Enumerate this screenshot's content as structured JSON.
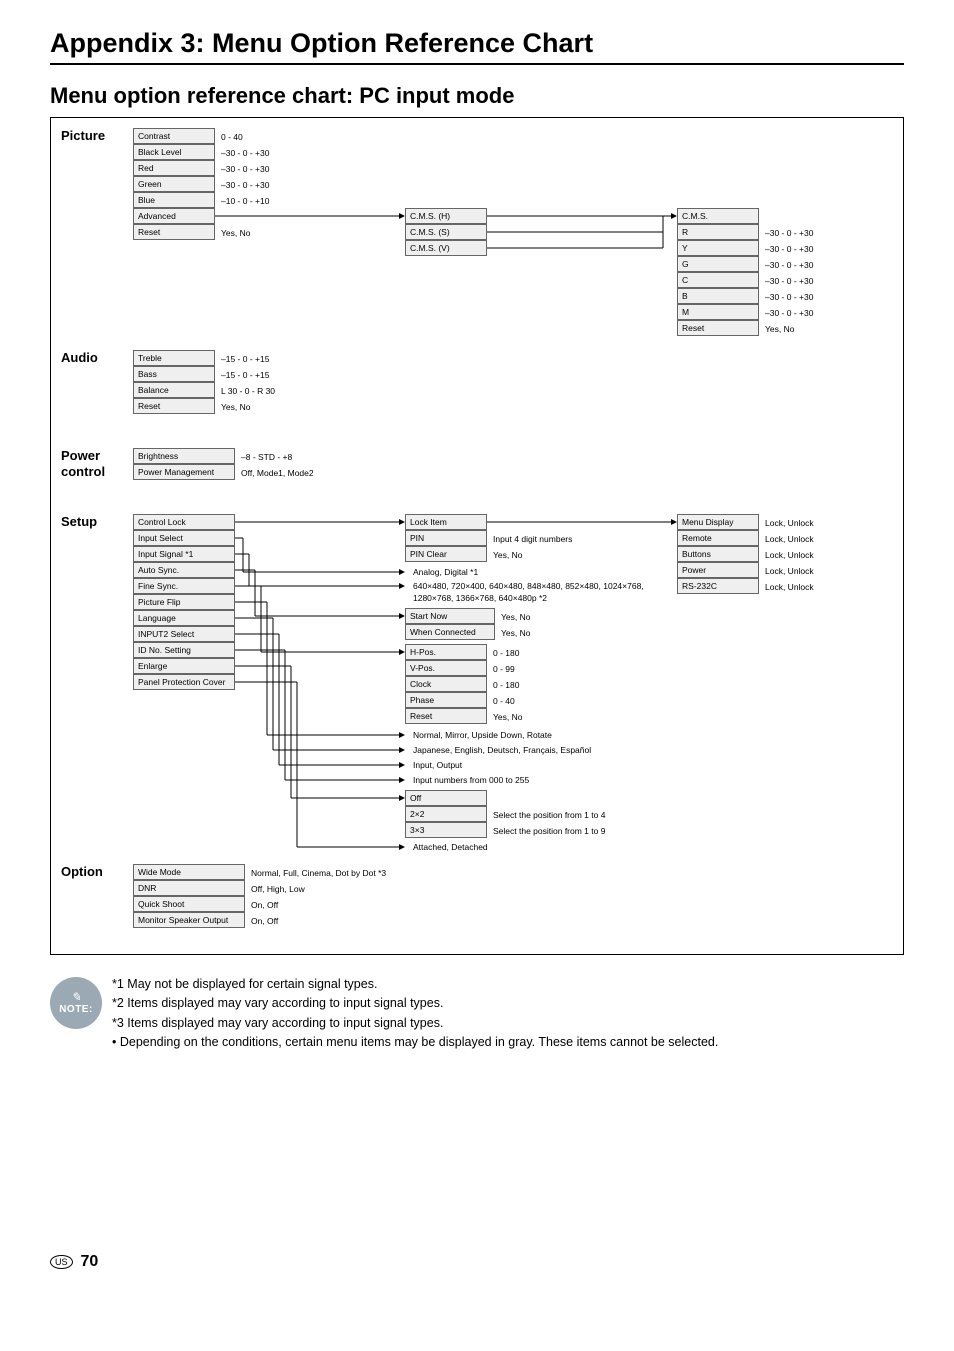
{
  "title": "Appendix 3: Menu Option Reference Chart",
  "subtitle": "Menu option reference chart: PC input mode",
  "sections": {
    "picture": {
      "label": "Picture",
      "rows": [
        {
          "name": "Contrast",
          "val": "0 - 40"
        },
        {
          "name": "Black Level",
          "val": "–30 - 0 - +30"
        },
        {
          "name": "Red",
          "val": "–30 - 0 - +30"
        },
        {
          "name": "Green",
          "val": "–30 - 0 - +30"
        },
        {
          "name": "Blue",
          "val": "–10 - 0 - +10"
        },
        {
          "name": "Advanced",
          "val": ""
        },
        {
          "name": "Reset",
          "val": "Yes, No"
        }
      ],
      "cms_mid": [
        {
          "name": "C.M.S. (H)"
        },
        {
          "name": "C.M.S. (S)"
        },
        {
          "name": "C.M.S. (V)"
        }
      ],
      "cms_right_head": "C.M.S.",
      "cms_right": [
        {
          "name": "R",
          "val": "–30 - 0 - +30"
        },
        {
          "name": "Y",
          "val": "–30 - 0 - +30"
        },
        {
          "name": "G",
          "val": "–30 - 0 - +30"
        },
        {
          "name": "C",
          "val": "–30 - 0 - +30"
        },
        {
          "name": "B",
          "val": "–30 - 0 - +30"
        },
        {
          "name": "M",
          "val": "–30 - 0 - +30"
        },
        {
          "name": "Reset",
          "val": "Yes, No"
        }
      ]
    },
    "audio": {
      "label": "Audio",
      "rows": [
        {
          "name": "Treble",
          "val": "–15 - 0 - +15"
        },
        {
          "name": "Bass",
          "val": "–15 - 0 - +15"
        },
        {
          "name": "Balance",
          "val": "L 30 - 0 - R 30"
        },
        {
          "name": "Reset",
          "val": "Yes, No"
        }
      ]
    },
    "power": {
      "label": "Power control",
      "rows": [
        {
          "name": "Brightness",
          "val": "–8 - STD - +8"
        },
        {
          "name": "Power Management",
          "val": "Off, Mode1, Mode2"
        }
      ]
    },
    "setup": {
      "label": "Setup",
      "rows": [
        {
          "name": "Control Lock"
        },
        {
          "name": "Input Select"
        },
        {
          "name": "Input Signal *1"
        },
        {
          "name": "Auto Sync."
        },
        {
          "name": "Fine Sync."
        },
        {
          "name": "Picture Flip"
        },
        {
          "name": "Language"
        },
        {
          "name": "INPUT2 Select"
        },
        {
          "name": "ID No. Setting"
        },
        {
          "name": "Enlarge"
        },
        {
          "name": "Panel Protection Cover"
        }
      ],
      "lock_col": [
        {
          "name": "Lock Item"
        },
        {
          "name": "PIN",
          "val": "Input 4 digit numbers"
        },
        {
          "name": "PIN Clear",
          "val": "Yes, No"
        }
      ],
      "lock_right": [
        {
          "name": "Menu Display",
          "val": "Lock, Unlock"
        },
        {
          "name": "Remote",
          "val": "Lock, Unlock"
        },
        {
          "name": "Buttons",
          "val": "Lock, Unlock"
        },
        {
          "name": "Power",
          "val": "Lock, Unlock"
        },
        {
          "name": "RS-232C",
          "val": "Lock, Unlock"
        }
      ],
      "inputselect_txt": "Analog, Digital *1",
      "inputsignal_txt": "640×480, 720×400, 640×480, 848×480, 852×480, 1024×768, 1280×768, 1366×768, 640×480p *2",
      "autosync_col": [
        {
          "name": "Start Now",
          "val": "Yes, No"
        },
        {
          "name": "When Connected",
          "val": "Yes, No"
        }
      ],
      "finesync_col": [
        {
          "name": "H-Pos.",
          "val": "0 - 180"
        },
        {
          "name": "V-Pos.",
          "val": "0 - 99"
        },
        {
          "name": "Clock",
          "val": "0 - 180"
        },
        {
          "name": "Phase",
          "val": "0 - 40"
        },
        {
          "name": "Reset",
          "val": "Yes, No"
        }
      ],
      "pictureflip_txt": "Normal, Mirror, Upside Down, Rotate",
      "language_txt": "Japanese, English, Deutsch, Français, Español",
      "input2_txt": "Input, Output",
      "idno_txt": "Input numbers from 000 to 255",
      "enlarge_col": [
        {
          "name": "Off",
          "val": ""
        },
        {
          "name": "2×2",
          "val": "Select the position from 1 to 4"
        },
        {
          "name": "3×3",
          "val": "Select the position from 1 to 9"
        }
      ],
      "panel_txt": "Attached, Detached"
    },
    "option": {
      "label": "Option",
      "rows": [
        {
          "name": "Wide Mode",
          "val": "Normal, Full, Cinema, Dot by Dot *3"
        },
        {
          "name": "DNR",
          "val": "Off, High, Low"
        },
        {
          "name": "Quick Shoot",
          "val": "On, Off"
        },
        {
          "name": "Monitor Speaker Output",
          "val": "On, Off"
        }
      ]
    }
  },
  "notes": {
    "badge": "NOTE:",
    "items": [
      "*1 May not be displayed for certain signal types.",
      "*2 Items displayed may vary according to input signal types.",
      "*3 Items displayed may vary according to input signal types.",
      "• Depending on the conditions, certain menu items may be displayed in gray. These items cannot be selected."
    ]
  },
  "footer": {
    "region": "US",
    "page": "70"
  }
}
